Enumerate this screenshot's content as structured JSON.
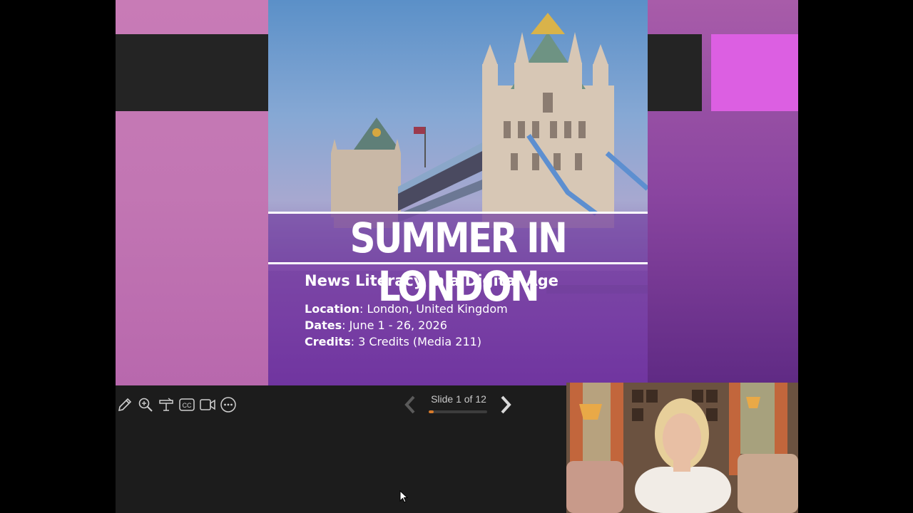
{
  "slide": {
    "title": "SUMMER IN LONDON",
    "subtitle": "News Literacy in a Digital Age",
    "details": [
      {
        "label": "Location",
        "value": ": London, United Kingdom"
      },
      {
        "label": "Dates",
        "value": ": June 1 - 26, 2026"
      },
      {
        "label": "Credits",
        "value": ": 3 Credits (Media 211)"
      }
    ],
    "colors": {
      "accent": "#dc5fe2",
      "dark_bar": "#242424",
      "purple": "#7a3a95"
    }
  },
  "toolbar": {
    "tools": [
      {
        "name": "pen-icon"
      },
      {
        "name": "zoom-icon"
      },
      {
        "name": "laser-pointer-icon"
      },
      {
        "name": "closed-captions-icon",
        "text": "CC"
      },
      {
        "name": "camera-icon"
      },
      {
        "name": "more-options-icon"
      }
    ]
  },
  "navigation": {
    "counter": "Slide 1 of 12",
    "current": 1,
    "total": 12,
    "progress_fraction": 0.083,
    "progress_color": "#d77a2a"
  }
}
